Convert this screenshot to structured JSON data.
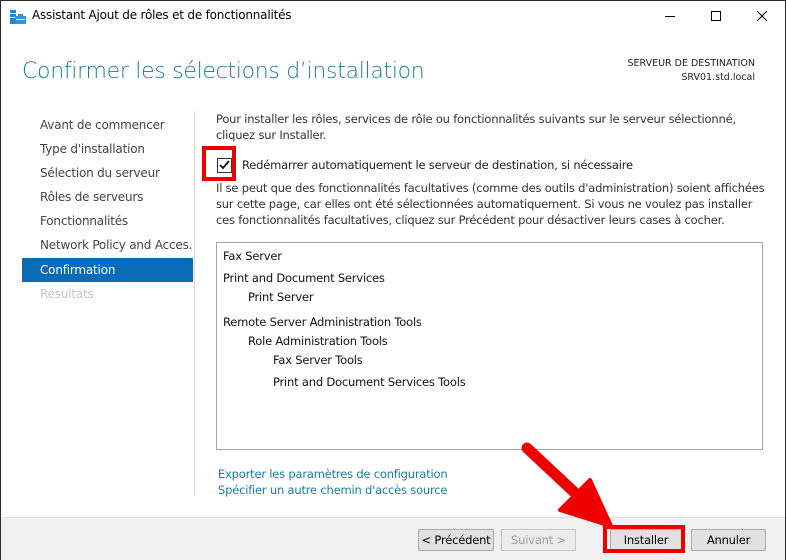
{
  "window": {
    "title": "Assistant Ajout de rôles et de fonctionnalités",
    "controls": {
      "minimize": "—",
      "maximize": "☐",
      "close": "✕"
    }
  },
  "header": {
    "title": "Confirmer les sélections d’installation",
    "destination_label": "SERVEUR DE DESTINATION",
    "destination_server": "SRV01.std.local"
  },
  "nav": {
    "items": [
      {
        "label": "Avant de commencer",
        "state": "normal"
      },
      {
        "label": "Type d'installation",
        "state": "normal"
      },
      {
        "label": "Sélection du serveur",
        "state": "normal"
      },
      {
        "label": "Rôles de serveurs",
        "state": "normal"
      },
      {
        "label": "Fonctionnalités",
        "state": "normal"
      },
      {
        "label": "Network Policy and Acces...",
        "state": "normal"
      },
      {
        "label": "Confirmation",
        "state": "active"
      },
      {
        "label": "Résultats",
        "state": "disabled"
      }
    ]
  },
  "content": {
    "intro": "Pour installer les rôles, services de rôle ou fonctionnalités suivants sur le serveur sélectionné, cliquez sur Installer.",
    "restart_checkbox": {
      "label": "Redémarrer automatiquement le serveur de destination, si nécessaire",
      "checked": true
    },
    "note": "Il se peut que des fonctionnalités facultatives (comme des outils d'administration) soient affichées sur cette page, car elles ont été sélectionnées automatiquement. Si vous ne voulez pas installer ces fonctionnalités facultatives, cliquez sur Précédent pour désactiver leurs cases à cocher.",
    "selections": [
      {
        "label": "Fax Server",
        "level": 0
      },
      {
        "label": "Print and Document Services",
        "level": 0
      },
      {
        "label": "Print Server",
        "level": 1
      },
      {
        "label": "Remote Server Administration Tools",
        "level": 0
      },
      {
        "label": "Role Administration Tools",
        "level": 1
      },
      {
        "label": "Fax Server Tools",
        "level": 2
      },
      {
        "label": "Print and Document Services Tools",
        "level": 2
      }
    ],
    "links": {
      "export": "Exporter les paramètres de configuration",
      "alt_source": "Spécifier un autre chemin d'accès source"
    }
  },
  "footer": {
    "previous": "< Précédent",
    "next": "Suivant >",
    "install": "Installer",
    "cancel": "Annuler"
  },
  "annotations": {
    "highlight_color": "#ee0000"
  },
  "colors": {
    "accent": "#0a6bb6",
    "title_blue": "#1b7d9b",
    "link": "#1b7d9b"
  }
}
